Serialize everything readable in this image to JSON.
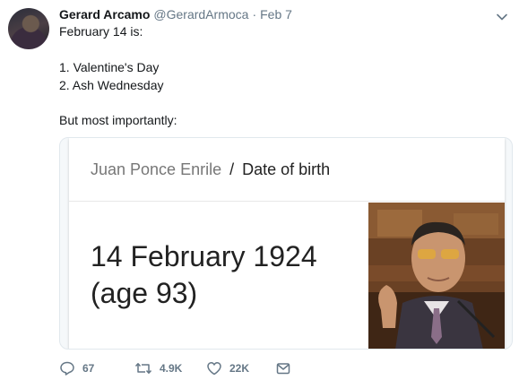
{
  "tweet": {
    "display_name": "Gerard Arcamo",
    "handle": "@GerardArmoca",
    "separator": "·",
    "timestamp": "Feb 7",
    "text_lines": [
      "February 14 is:",
      "1. Valentine's Day",
      "2. Ash Wednesday",
      "But most importantly:"
    ]
  },
  "card": {
    "entity": "Juan Ponce Enrile",
    "separator": "/",
    "attribute": "Date of birth",
    "value_line1": "14 February 1924",
    "value_line2": "(age 93)"
  },
  "actions": {
    "reply_count": "67",
    "retweet_count": "4.9K",
    "like_count": "22K"
  },
  "icons": {
    "caret": "chevron-down-icon",
    "reply": "reply-icon",
    "retweet": "retweet-icon",
    "like": "heart-icon",
    "dm": "envelope-icon"
  },
  "colors": {
    "text": "#14171a",
    "secondary": "#657786",
    "border": "#e1e8ed"
  }
}
